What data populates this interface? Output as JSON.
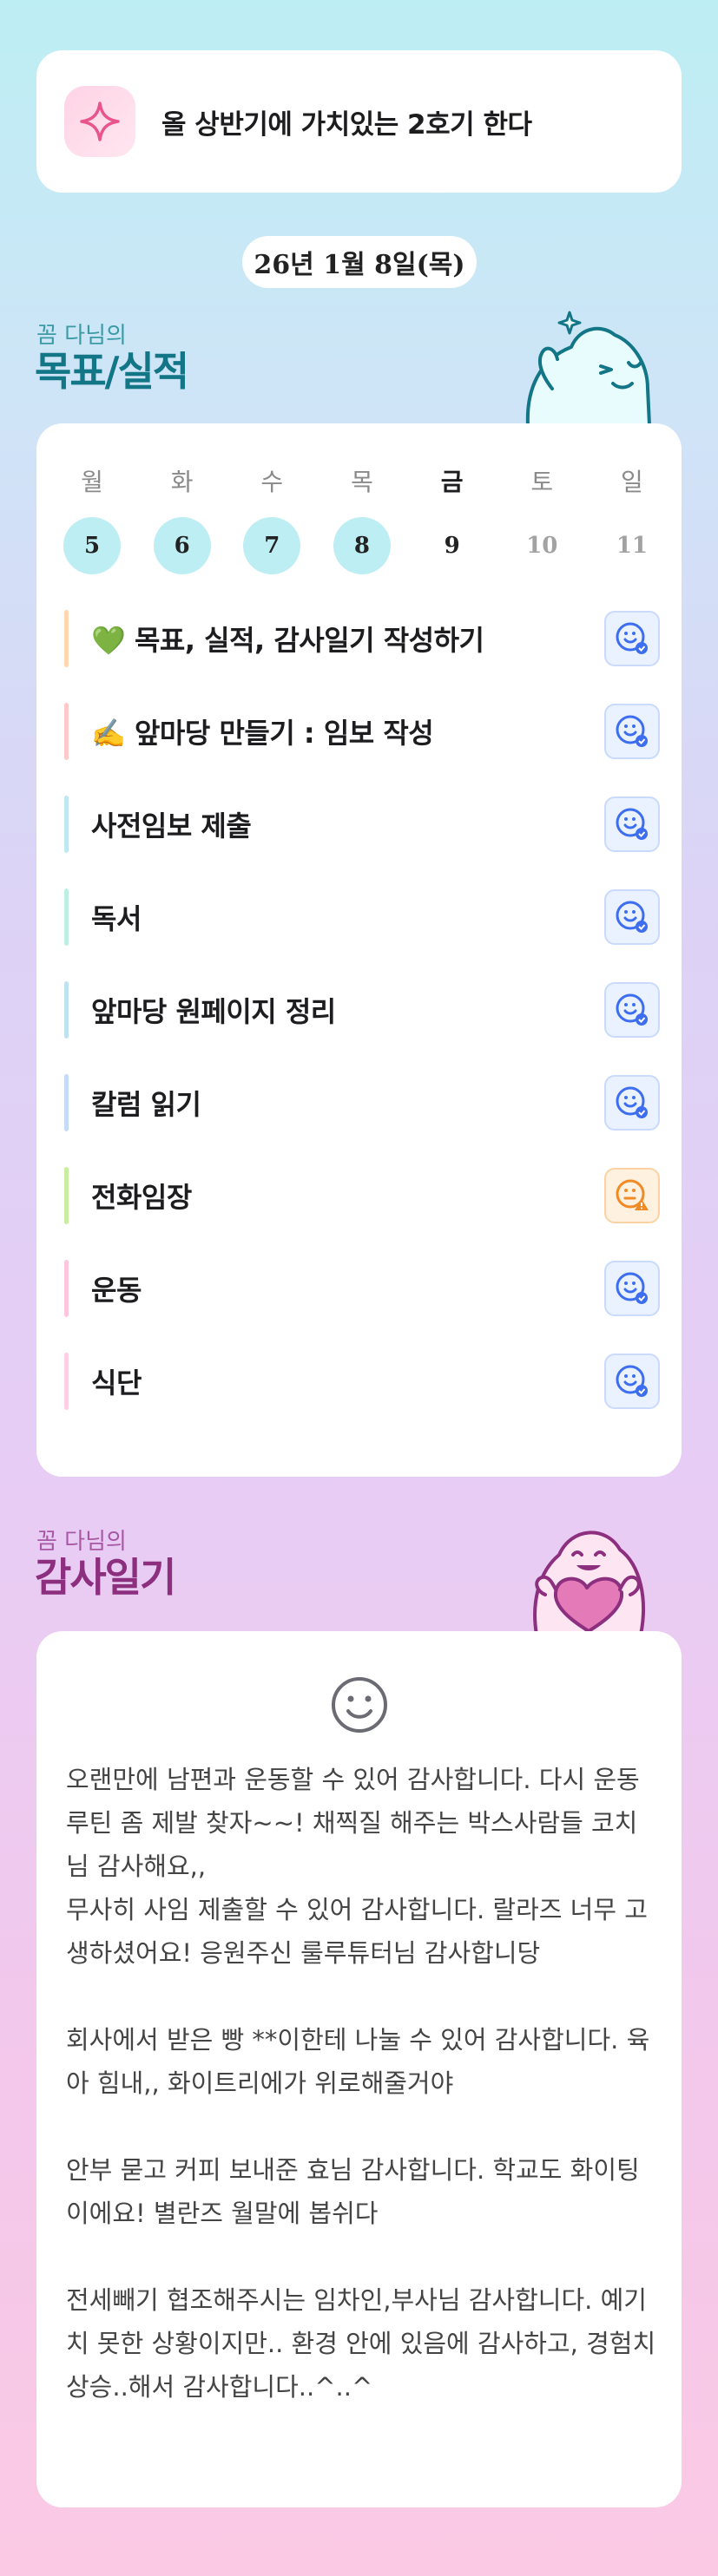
{
  "header": {
    "goal_text": "올 상반기에 가치있는 2호기 한다",
    "icon": "sparkle-icon"
  },
  "date": "26년 1월 8일(목)",
  "goals_section": {
    "subtitle": "꼼 다님의",
    "title": "목표/실적"
  },
  "week": [
    {
      "name": "월",
      "num": "5",
      "status": "done"
    },
    {
      "name": "화",
      "num": "6",
      "status": "done"
    },
    {
      "name": "수",
      "num": "7",
      "status": "done"
    },
    {
      "name": "목",
      "num": "8",
      "status": "done"
    },
    {
      "name": "금",
      "num": "9",
      "status": "today"
    },
    {
      "name": "토",
      "num": "10",
      "status": "future"
    },
    {
      "name": "일",
      "num": "11",
      "status": "future"
    }
  ],
  "tasks": [
    {
      "label": "💚 목표, 실적, 감사일기 작성하기",
      "bar": "#ffd7b0",
      "state": "blue",
      "icon": "smile-check-icon"
    },
    {
      "label": "✍️ 앞마당 만들기 : 임보 작성",
      "bar": "#ffc9c9",
      "state": "blue",
      "icon": "smile-check-icon"
    },
    {
      "label": "사전임보 제출",
      "bar": "#bfe8f3",
      "state": "blue",
      "icon": "smile-check-icon"
    },
    {
      "label": "독서",
      "bar": "#bfeee2",
      "state": "blue",
      "icon": "smile-check-icon"
    },
    {
      "label": "앞마당 원페이지 정리",
      "bar": "#bfe2f3",
      "state": "blue",
      "icon": "smile-check-icon"
    },
    {
      "label": "칼럼 읽기",
      "bar": "#c4ddf5",
      "state": "blue",
      "icon": "smile-check-icon"
    },
    {
      "label": "전화임장",
      "bar": "#c8ef9f",
      "state": "orange",
      "icon": "smile-warning-icon"
    },
    {
      "label": "운동",
      "bar": "#ffc7de",
      "state": "blue",
      "icon": "smile-check-icon"
    },
    {
      "label": "식단",
      "bar": "#ffcfe2",
      "state": "blue",
      "icon": "smile-check-icon"
    }
  ],
  "gratitude_section": {
    "subtitle": "꼼 다님의",
    "title": "감사일기",
    "icon": "smile-icon",
    "paragraphs": [
      "오랜만에 남편과 운동할 수 있어 감사합니다. 다시 운동 루틴 좀 제발 찾자~~! 채찍질 해주는 박스사람들 코치님 감사해요,,",
      "무사히 사임 제출할 수 있어 감사합니다. 랄라즈 너무 고생하셨어요! 응원주신 룰루튜터님 감사합니당",
      "회사에서 받은 빵 **이한테 나눌 수 있어 감사합니다. 육아 힘내,, 화이트리에가 위로해줄거야",
      "안부 묻고 커피 보내준 효님 감사합니다. 학교도 화이팅이에요! 별란즈 월말에 봅쉬다",
      "전세빼기 협조해주시는 임차인,부사님 감사합니다. 예기치 못한 상황이지만.. 환경 안에 있음에 감사하고, 경험치 상승..해서 감사합니다..^..^"
    ]
  },
  "colors": {
    "accent_teal": "#137687",
    "accent_purple": "#8d2f7f",
    "done_day": "#bdeef4",
    "check_blue": "#3d6ef0",
    "warning_orange": "#f08a24"
  }
}
